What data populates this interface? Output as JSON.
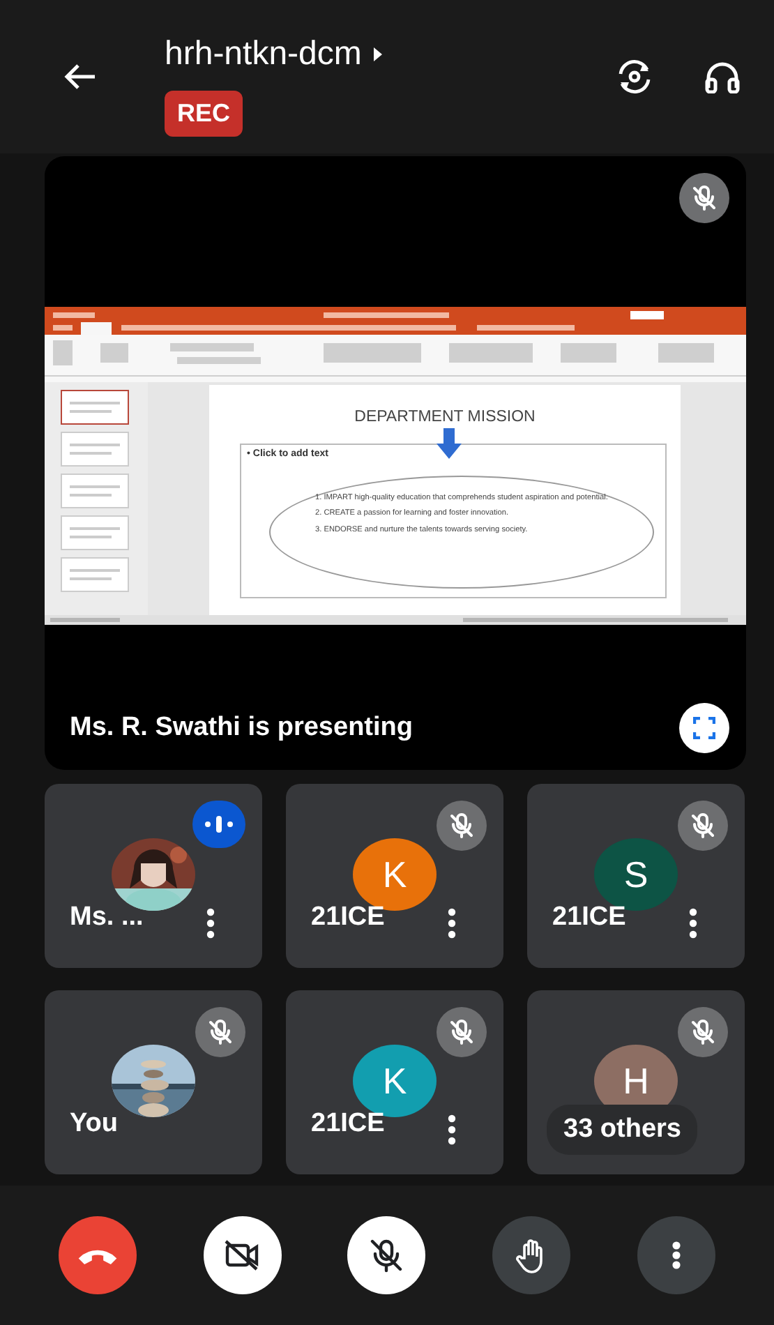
{
  "header": {
    "meeting_code": "hrh-ntkn-dcm",
    "recording_badge": "REC"
  },
  "presentation": {
    "muted": true,
    "caption": "Ms. R. Swathi is presenting",
    "slide": {
      "title": "DEPARTMENT MISSION",
      "body_placeholder": "• Click to add text",
      "items": [
        "1. IMPART high-quality education that comprehends student aspiration and potential.",
        "2. CREATE a passion for learning and foster innovation.",
        "3. ENDORSE and nurture the talents towards serving society."
      ]
    }
  },
  "participants": [
    {
      "name": "Ms. ...",
      "speaking": true,
      "muted": false,
      "menu": true
    },
    {
      "name": "21ICE",
      "avatar": {
        "kind": "initial",
        "initial": "K",
        "color": "#e8710a"
      },
      "speaking": false,
      "muted": true,
      "menu": true
    },
    {
      "name": "21ICE",
      "avatar": {
        "kind": "initial",
        "initial": "S",
        "color": "#0d5445"
      },
      "speaking": false,
      "muted": true,
      "menu": true
    },
    {
      "name": "You",
      "speaking": false,
      "muted": true,
      "menu": false
    },
    {
      "name": "21ICE",
      "avatar": {
        "kind": "initial",
        "initial": "K",
        "color": "#129eaf"
      },
      "speaking": false,
      "muted": true,
      "menu": true
    },
    {
      "avatar": {
        "kind": "initial",
        "initial": "H",
        "color": "#8d6e63"
      },
      "speaking": false,
      "muted": true,
      "menu": false,
      "overlay": "33 others"
    }
  ],
  "controls": [
    {
      "kind": "end_call"
    },
    {
      "kind": "camera",
      "on": false
    },
    {
      "kind": "mic",
      "on": false
    },
    {
      "kind": "hand"
    },
    {
      "kind": "more"
    }
  ]
}
